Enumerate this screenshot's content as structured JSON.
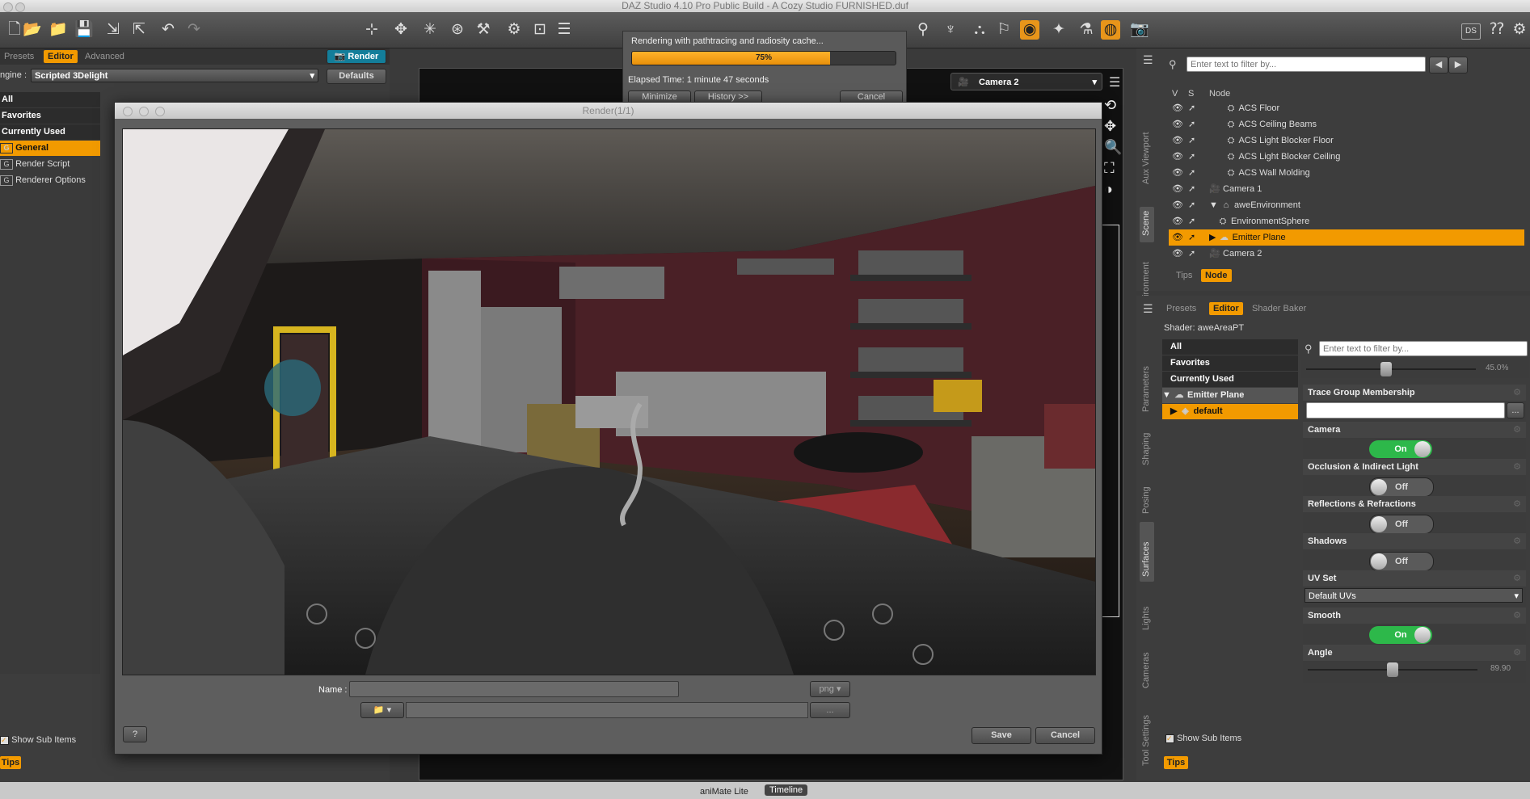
{
  "window_title": "DAZ Studio 4.10 Pro Public Build - A Cozy Studio FURNISHED.duf",
  "toolbar": {
    "left_icons": [
      "new-icon",
      "open-icon",
      "merge-icon",
      "save-icon",
      "import-icon",
      "export-icon",
      "undo-icon",
      "redo-icon"
    ],
    "right_icons": [
      "node-select-icon",
      "transform-icon",
      "joint-editor-icon",
      "rotate-icon",
      "tool-icon",
      "region-nav-icon",
      "surface-select-icon",
      "content-menu-icon",
      "geometry-icon",
      "spot-render-icon"
    ],
    "ds_label": "DS"
  },
  "render_settings": {
    "tabs": [
      "Presets",
      "Editor",
      "Advanced"
    ],
    "active_tab": "Editor",
    "render_button": "Render",
    "engine_label": "ngine :",
    "engine_value": "Scripted 3Delight",
    "defaults_button": "Defaults",
    "categories": [
      "All",
      "Favorites",
      "Currently Used"
    ],
    "items": [
      {
        "label": "General",
        "active": true
      },
      {
        "label": "Render Script",
        "active": false
      },
      {
        "label": "Renderer Options",
        "active": false
      }
    ],
    "show_sub_items": "Show Sub Items",
    "tips": "Tips"
  },
  "progress": {
    "message": "Rendering with pathtracing and radiosity cache...",
    "percent": 75,
    "percent_label": "75%",
    "elapsed": "Elapsed Time:  1 minute 47 seconds",
    "minimize": "Minimize",
    "history": "History >>",
    "cancel": "Cancel"
  },
  "viewport": {
    "camera": "Camera 2"
  },
  "render_window": {
    "title": "Render(1/1)",
    "name_label": "Name :",
    "name_value": "",
    "format": "png",
    "browse": "...",
    "help": "?",
    "save": "Save",
    "cancel": "Cancel"
  },
  "scene": {
    "filter_placeholder": "Enter text to filter by...",
    "columns": [
      "V",
      "S",
      "Node"
    ],
    "vertical_tabs": [
      "Aux Viewport",
      "Scene",
      "Environment"
    ],
    "active_vtab": "Scene",
    "nodes": [
      {
        "label": "ACS Floor",
        "indent": 3,
        "icon": "prop"
      },
      {
        "label": "ACS Ceiling Beams",
        "indent": 3,
        "icon": "prop"
      },
      {
        "label": "ACS Light Blocker Floor",
        "indent": 3,
        "icon": "prop"
      },
      {
        "label": "ACS Light Blocker Ceiling",
        "indent": 3,
        "icon": "prop"
      },
      {
        "label": "ACS Wall Molding",
        "indent": 3,
        "icon": "prop"
      },
      {
        "label": "Camera 1",
        "indent": 1,
        "icon": "camera"
      },
      {
        "label": "aweEnvironment",
        "indent": 1,
        "icon": "env",
        "expand": "▼"
      },
      {
        "label": "EnvironmentSphere",
        "indent": 2,
        "icon": "prop"
      },
      {
        "label": "Emitter Plane",
        "indent": 1,
        "icon": "light",
        "selected": true,
        "expand": "▶"
      },
      {
        "label": "Camera 2",
        "indent": 1,
        "icon": "camera"
      }
    ],
    "bottom_tabs": [
      "Tips",
      "Node"
    ],
    "active_bottom_tab": "Node"
  },
  "surfaces": {
    "tabs": [
      "Presets",
      "Editor",
      "Shader Baker"
    ],
    "active_tab": "Editor",
    "shader": "Shader: aweAreaPT",
    "categories": [
      "All",
      "Favorites",
      "Currently Used"
    ],
    "tree": [
      {
        "label": "Emitter Plane",
        "expand": "▼"
      },
      {
        "label": "default",
        "selected": true
      }
    ],
    "filter_placeholder": "Enter text to filter by...",
    "slider_top_value": "45.0%",
    "properties": [
      {
        "name": "Trace Group Membership",
        "kind": "text"
      },
      {
        "name": "Camera",
        "kind": "toggle",
        "value": "On"
      },
      {
        "name": "Occlusion & Indirect Light",
        "kind": "toggle",
        "value": "Off"
      },
      {
        "name": "Reflections & Refractions",
        "kind": "toggle",
        "value": "Off"
      },
      {
        "name": "Shadows",
        "kind": "toggle",
        "value": "Off"
      },
      {
        "name": "UV Set",
        "kind": "select",
        "value": "Default UVs"
      },
      {
        "name": "Smooth",
        "kind": "toggle",
        "value": "On"
      },
      {
        "name": "Angle",
        "kind": "slider",
        "value": "89.90"
      }
    ],
    "vertical_tabs": [
      "Parameters",
      "Shaping",
      "Posing",
      "Surfaces",
      "Lights",
      "Cameras",
      "Tool Settings"
    ],
    "active_vtab": "Surfaces",
    "show_sub_items": "Show Sub Items",
    "tips": "Tips"
  },
  "bottom_tabs": [
    "aniMate Lite",
    "Timeline"
  ],
  "active_bottom_tab": "Timeline",
  "colors": {
    "accent": "#f29a00",
    "toggle_on": "#2db84a",
    "wall": "#5a2630"
  }
}
